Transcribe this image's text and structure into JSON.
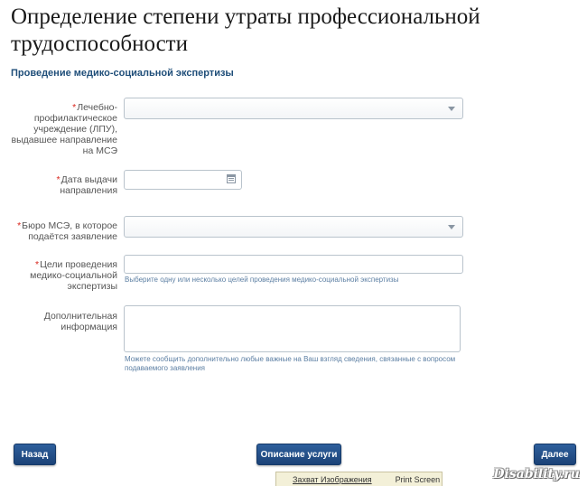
{
  "page": {
    "title": "Определение степени утраты профессиональной трудоспособности",
    "section_title": "Проведение медико-социальной экспертизы"
  },
  "form": {
    "lpu": {
      "label": "Лечебно-профилактическое учреждение (ЛПУ), выдавшее направление на МСЭ",
      "required": true,
      "value": ""
    },
    "issue_date": {
      "label": "Дата выдачи направления",
      "required": true,
      "value": ""
    },
    "bureau": {
      "label": "Бюро МСЭ, в которое подаётся заявление",
      "required": true,
      "value": ""
    },
    "goals": {
      "label": "Цели проведения медико-социальной экспертизы",
      "required": true,
      "value": "",
      "hint": "Выберите одну или несколько целей проведения медико-социальной экспертизы"
    },
    "additional": {
      "label": "Дополнительная информация",
      "required": false,
      "value": "",
      "hint": "Можете сообщить дополнительно любые важные на Ваш взгляд сведения, связанные с вопросом подаваемого заявления"
    }
  },
  "buttons": {
    "back": "Назад",
    "service_description": "Описание услуги",
    "next": "Далее"
  },
  "taskbar": {
    "capture": "Захват Изображения",
    "print_screen": "Print Screen"
  },
  "watermark": "Disability.ru"
}
